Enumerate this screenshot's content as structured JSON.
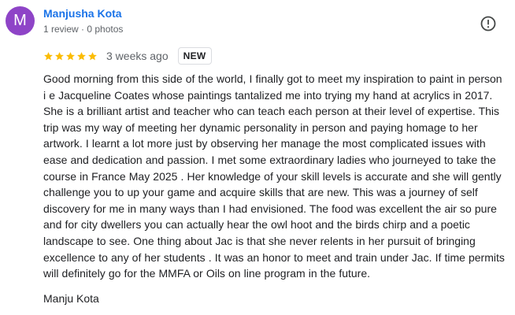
{
  "reviewer": {
    "initial": "M",
    "name": "Manjusha Kota",
    "meta": "1 review · 0 photos",
    "avatar_color": "#8e44c7"
  },
  "report_icon": "exclamation-circle-icon",
  "rating": {
    "stars": 5,
    "max_stars": 5,
    "star_color": "#fbbc04",
    "date": "3 weeks ago",
    "badge": "NEW"
  },
  "review": {
    "text": "Good morning from this side of the world, I finally got to meet my inspiration to paint in person i e Jacqueline Coates whose paintings tantalized me into trying my hand at acrylics in 2017. She is a brilliant artist and teacher who can teach each person at their level of expertise. This trip was my way of meeting her dynamic personality in person and paying homage to her artwork. I learnt a lot more just by observing her manage the most complicated issues with ease and dedication and passion. I met some extraordinary ladies who journeyed to take the course in France May 2025 . Her knowledge of your skill levels is accurate and she will gently challenge you to up your game and acquire skills that are new. This was a journey of self discovery for me in many ways than I had envisioned. The food was excellent the air so pure and for city dwellers you can actually hear the owl hoot and the birds chirp and a poetic landscape to see. One thing about Jac is that she never relents in her pursuit of bringing excellence to any of her students . It was an honor to meet and train under Jac. If time permits will definitely go for the MMFA or Oils on line program in the future.",
    "signature": "Manju Kota"
  }
}
